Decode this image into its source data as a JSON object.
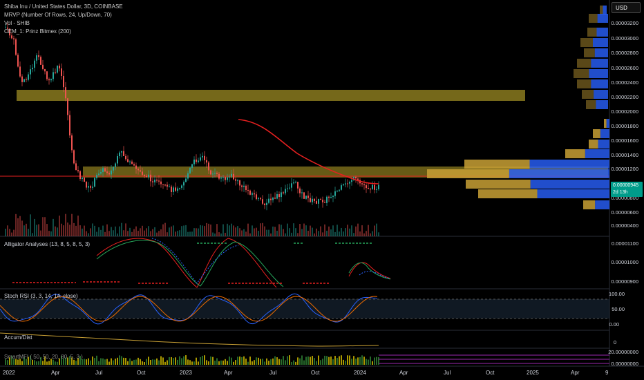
{
  "legend": {
    "symbol_line": "Shiba Inu / United States Dollar, 3D, COINBASE",
    "indicator_1": "MRVP (Number Of Rows, 24, Up/Down, 70)",
    "indicator_2": "Vol - SHIB",
    "indicator_3": "CEM_1: Prinz Bitmex (200)"
  },
  "currency_button": "USD",
  "price_axis": [
    "0.00003200",
    "0.00003000",
    "0.00002800",
    "0.00002600",
    "0.00002400",
    "0.00002200",
    "0.00002000",
    "0.00001800",
    "0.00001600",
    "0.00001400",
    "0.00001200",
    "0.00001000",
    "0.00000800",
    "0.00000600",
    "0.00000400"
  ],
  "last_price": {
    "value": "0.00000945",
    "countdown": "2d 13h"
  },
  "panes": {
    "alligator": {
      "title": "Alligator Analyses (13, 8, 5, 8, 5, 3)",
      "axis": [
        "0.00001100",
        "0.00001000",
        "0.00000900"
      ]
    },
    "stoch_rsi": {
      "title": "Stoch RSI (3, 3, 14, 14, close)",
      "axis": [
        "100.00",
        "50.00",
        "0.00"
      ]
    },
    "accum_dist": {
      "title": "Accum/Dist",
      "axis": [
        "0"
      ]
    },
    "smart_mfi": {
      "title": "SmartMFI ( 50, 50, 20, 80, 5, 3 )",
      "axis": [
        "20.00000000",
        "0.00000000"
      ]
    }
  },
  "time_axis": [
    "2022",
    "Apr",
    "Jul",
    "Oct",
    "2023",
    "Apr",
    "Jul",
    "Oct",
    "2024",
    "Apr",
    "Jul",
    "Oct",
    "2025",
    "Apr",
    "9"
  ],
  "colors": {
    "bull": "#26a69a",
    "bear": "#ef5350",
    "zone": "#8a7a1e",
    "vp_up": "#2962ff",
    "vp_down": "#c8a035",
    "cem": "#e62020"
  }
}
